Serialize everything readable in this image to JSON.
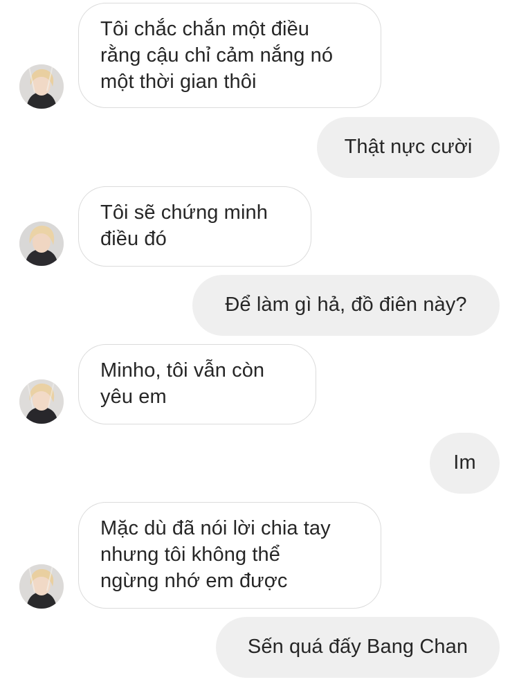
{
  "conversation": {
    "messages": [
      {
        "side": "incoming",
        "text": "Tôi chắc chắn một điều\nrằng cậu chỉ cảm nắng nó\nmột thời gian thôi"
      },
      {
        "side": "outgoing",
        "text": "Thật nực cười"
      },
      {
        "side": "incoming",
        "text": "Tôi sẽ chứng minh\nđiều đó"
      },
      {
        "side": "outgoing",
        "text": "Để làm gì hả, đồ điên này?"
      },
      {
        "side": "incoming",
        "text": " Minho, tôi vẫn còn\nyêu em"
      },
      {
        "side": "outgoing",
        "text": "Im"
      },
      {
        "side": "incoming",
        "text": " Mặc dù đã nói lời chia tay\nnhưng tôi không thể\nngừng nhớ em được"
      },
      {
        "side": "outgoing",
        "text": "Sến quá đấy Bang Chan"
      }
    ]
  },
  "colors": {
    "incoming_bubble_bg": "#ffffff",
    "incoming_bubble_border": "#dbdbdb",
    "outgoing_bubble_bg": "#efefef",
    "text": "#262626"
  },
  "icons": {
    "avatar": "sender-avatar-photo"
  }
}
